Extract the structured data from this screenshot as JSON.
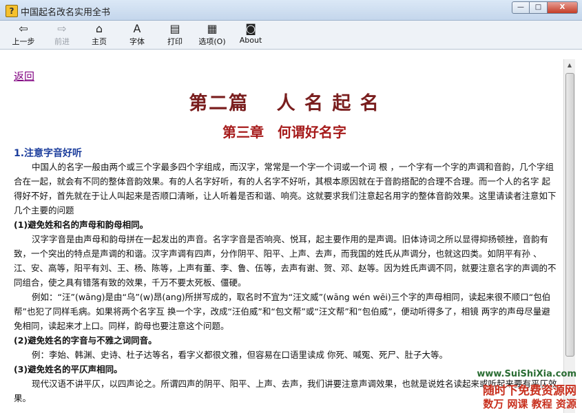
{
  "window": {
    "title": "中国起名改名实用全书",
    "controls": {
      "minimize": "—",
      "maximize": "□",
      "close": "X"
    }
  },
  "toolbar": [
    {
      "label": "上一步",
      "icon": "back-arrow-icon",
      "glyph": "⇦",
      "enabled": true
    },
    {
      "label": "前进",
      "icon": "forward-arrow-icon",
      "glyph": "⇨",
      "enabled": false
    },
    {
      "label": "主页",
      "icon": "home-icon",
      "glyph": "⌂",
      "enabled": true
    },
    {
      "label": "字体",
      "icon": "font-icon",
      "glyph": "A",
      "enabled": true
    },
    {
      "label": "打印",
      "icon": "printer-icon",
      "glyph": "▤",
      "enabled": true
    },
    {
      "label": "选项(O)",
      "icon": "options-icon",
      "glyph": "▦",
      "enabled": true
    },
    {
      "label": "About",
      "icon": "about-icon",
      "glyph": "◙",
      "enabled": true
    }
  ],
  "document": {
    "back_link": "返回",
    "part_title": "第二篇　 人 名 起 名",
    "chapter_title": "第三章　何谓好名字",
    "section_title": "1.注意字音好听",
    "paragraphs": [
      {
        "style": "indent",
        "text": "中国人的名字一般由两个或三个字最多四个字组成，而汉字，常常是一个字一个词或一个词 根 ，一个字有一个字的声调和音韵，几个字组合在一起，就会有不同的整体音韵效果。有的人名字好听，有的人名字不好听，其根本原因就在于音韵搭配的合理不合理。而一个人的名字 起得好不好，首先就在于让人叫起来是否顺口清晰，让人听着是否和谐、响亮。这就要求我们注意起名用字的整体音韵效果。这里请读者注意如下几个主要的问题"
      },
      {
        "style": "bold",
        "text": "(1)避免姓和名的声母和韵母相同。"
      },
      {
        "style": "indent",
        "text": "汉字字音是由声母和韵母拼在一起发出的声音。名字字音是否响亮、悦耳，起主要作用的是声调。旧体诗词之所以显得抑扬顿挫，音韵有致，一个突出的特点是声调的和谐。汉字声调有四声，分作阴平、阳平、上声、去声，而我国的姓氏从声调分，也就这四类。如阴平有孙 、江、安、高等，阳平有刘、王、杨、陈等，上声有董、李、鲁、伍等，去声有谢、贺、邓、赵等。因为姓氏声调不同，就要注意名字的声调的不同组合，使之具有错落有致的效果，千万不要太死板、僵硬。"
      },
      {
        "style": "indent",
        "text": "例如：“汪”(wāng)是由“乌”(w)昂(ang)所拼写成的，取名时不宜为“汪文威”(wāng wén wēi)三个字的声母相同，读起来很不顺口“包伯帮”也犯了同样毛病。如果将两个名字互 换一个字，改成“汪伯威”和“包文帮”或“汪文帮”和“包伯威”，便动听得多了，相镜 两字的声母尽量避免相同，读起来才上口。同样，韵母也要注意这个问题。"
      },
      {
        "style": "bold",
        "text": "(2)避免姓名的字音与不雅之词同音。"
      },
      {
        "style": "indent",
        "text": "例：李始、韩渊、史诗、杜子达等名，看字义都很文雅，但容易在口语里读成 你死、喊冤、死尸、肚子大等。"
      },
      {
        "style": "bold",
        "text": "(3)避免姓名的平仄声相同。"
      },
      {
        "style": "indent",
        "text": "现代汉语不讲平仄，以四声论之。所谓四声的阴平、阳平、上声、去声，我们讲要注意声调效果，也就是说姓名读起来或听起来要有平仄效果。"
      }
    ]
  },
  "watermark": {
    "line1": "www.SuiShiXia.com",
    "line2": "随时下免费资源网",
    "line3": "数万 网课 教程 资源"
  },
  "colors": {
    "part_title": "#7a1e1e",
    "chapter_title": "#a61b1b",
    "section_title": "#1b3d9c",
    "back_link": "#800080"
  }
}
